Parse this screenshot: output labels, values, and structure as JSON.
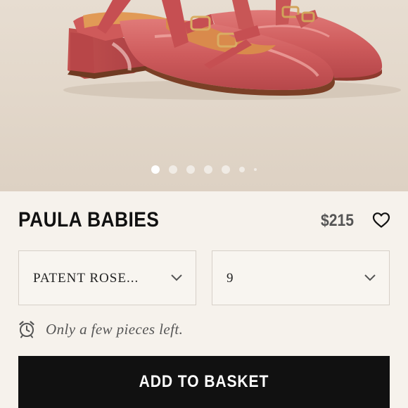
{
  "product": {
    "name": "PAULA BABIES",
    "price": "$215"
  },
  "gallery": {
    "total_images": 7,
    "active_index": 0
  },
  "options": {
    "color": {
      "selected": "PATENT ROSE..."
    },
    "size": {
      "selected": "9"
    }
  },
  "stock_message": "Only a few pieces left.",
  "cta": {
    "label": "ADD TO BASKET"
  },
  "icons": {
    "favorite": "heart-outline-icon",
    "dropdown": "chevron-down-icon",
    "stock": "alarm-clock-icon"
  },
  "colors": {
    "shoe": "#cc5a5b",
    "background": "#f6f2ec",
    "button": "#111111",
    "button_text": "#ffffff"
  }
}
